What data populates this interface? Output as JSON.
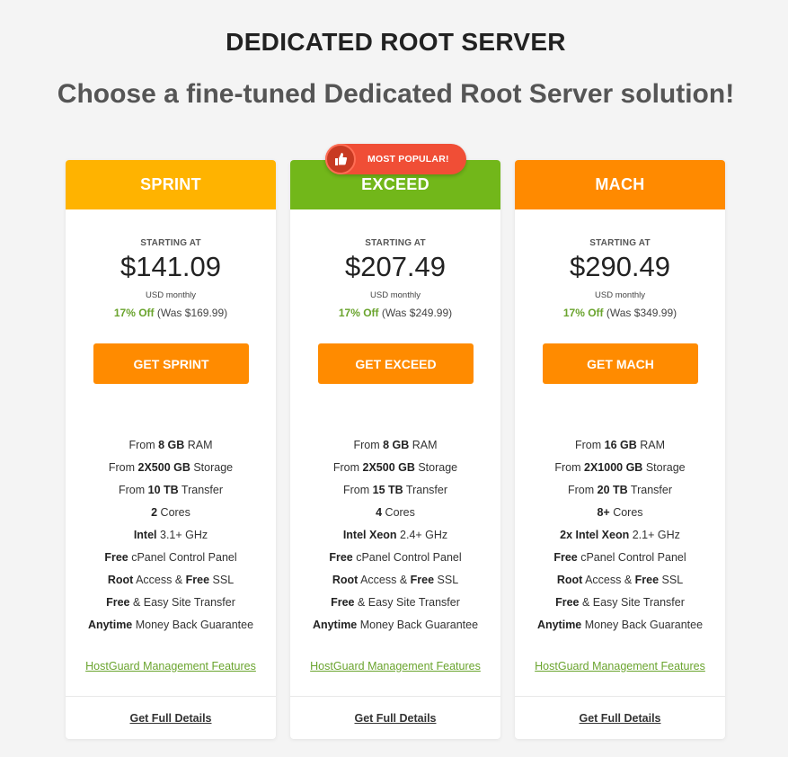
{
  "page": {
    "title": "DEDICATED ROOT SERVER",
    "subtitle": "Choose a fine-tuned Dedicated Root Server solution!"
  },
  "colors": {
    "sprint_header": "#ffb300",
    "exceed_header": "#72b71a",
    "mach_header": "#ff8a00",
    "button": "#ff8b00",
    "discount_green": "#6aa42e",
    "badge": "#f04e36"
  },
  "badge": {
    "label": "MOST POPULAR!",
    "icon": "thumbs-up-icon"
  },
  "plans": [
    {
      "name": "SPRINT",
      "starting_label": "STARTING AT",
      "price": "$141.09",
      "period": "USD monthly",
      "discount": "17% Off",
      "was_prefix": "(Was ",
      "was_price": "$169.99",
      "was_suffix": ")",
      "cta": "GET SPRINT",
      "features": [
        {
          "pre": "From ",
          "bold": "8 GB",
          "post": " RAM"
        },
        {
          "pre": "From ",
          "bold": "2X500 GB",
          "post": " Storage"
        },
        {
          "pre": "From ",
          "bold": "10 TB",
          "post": " Transfer"
        },
        {
          "pre": "",
          "bold": "2",
          "post": " Cores"
        },
        {
          "pre": "",
          "bold": "Intel",
          "post": " 3.1+ GHz"
        },
        {
          "pre": "",
          "bold": "Free",
          "post": " cPanel Control Panel"
        },
        {
          "pre": "",
          "bold": "Root",
          "mid": " Access & ",
          "bold2": "Free",
          "post": " SSL"
        },
        {
          "pre": "",
          "bold": "Free",
          "post": " & Easy Site Transfer"
        },
        {
          "pre": "",
          "bold": "Anytime",
          "post": " Money Back Guarantee"
        }
      ],
      "hostguard": "HostGuard Management Features",
      "details": "Get Full Details"
    },
    {
      "name": "EXCEED",
      "starting_label": "STARTING AT",
      "price": "$207.49",
      "period": "USD monthly",
      "discount": "17% Off",
      "was_prefix": "(Was ",
      "was_price": "$249.99",
      "was_suffix": ")",
      "cta": "GET EXCEED",
      "features": [
        {
          "pre": "From ",
          "bold": "8 GB",
          "post": " RAM"
        },
        {
          "pre": "From ",
          "bold": "2X500 GB",
          "post": " Storage"
        },
        {
          "pre": "From ",
          "bold": "15 TB",
          "post": " Transfer"
        },
        {
          "pre": "",
          "bold": "4",
          "post": " Cores"
        },
        {
          "pre": "",
          "bold": "Intel Xeon",
          "post": " 2.4+ GHz"
        },
        {
          "pre": "",
          "bold": "Free",
          "post": " cPanel Control Panel"
        },
        {
          "pre": "",
          "bold": "Root",
          "mid": " Access & ",
          "bold2": "Free",
          "post": " SSL"
        },
        {
          "pre": "",
          "bold": "Free",
          "post": " & Easy Site Transfer"
        },
        {
          "pre": "",
          "bold": "Anytime",
          "post": " Money Back Guarantee"
        }
      ],
      "hostguard": "HostGuard Management Features",
      "details": "Get Full Details"
    },
    {
      "name": "MACH",
      "starting_label": "STARTING AT",
      "price": "$290.49",
      "period": "USD monthly",
      "discount": "17% Off",
      "was_prefix": "(Was ",
      "was_price": "$349.99",
      "was_suffix": ")",
      "cta": "GET MACH",
      "features": [
        {
          "pre": "From ",
          "bold": "16 GB",
          "post": " RAM"
        },
        {
          "pre": "From ",
          "bold": "2X1000 GB",
          "post": " Storage"
        },
        {
          "pre": "From ",
          "bold": "20 TB",
          "post": " Transfer"
        },
        {
          "pre": "",
          "bold": "8+",
          "post": " Cores"
        },
        {
          "pre": "",
          "bold": "2x Intel Xeon",
          "post": " 2.1+ GHz"
        },
        {
          "pre": "",
          "bold": "Free",
          "post": " cPanel Control Panel"
        },
        {
          "pre": "",
          "bold": "Root",
          "mid": " Access & ",
          "bold2": "Free",
          "post": " SSL"
        },
        {
          "pre": "",
          "bold": "Free",
          "post": " & Easy Site Transfer"
        },
        {
          "pre": "",
          "bold": "Anytime",
          "post": " Money Back Guarantee"
        }
      ],
      "hostguard": "HostGuard Management Features",
      "details": "Get Full Details"
    }
  ]
}
